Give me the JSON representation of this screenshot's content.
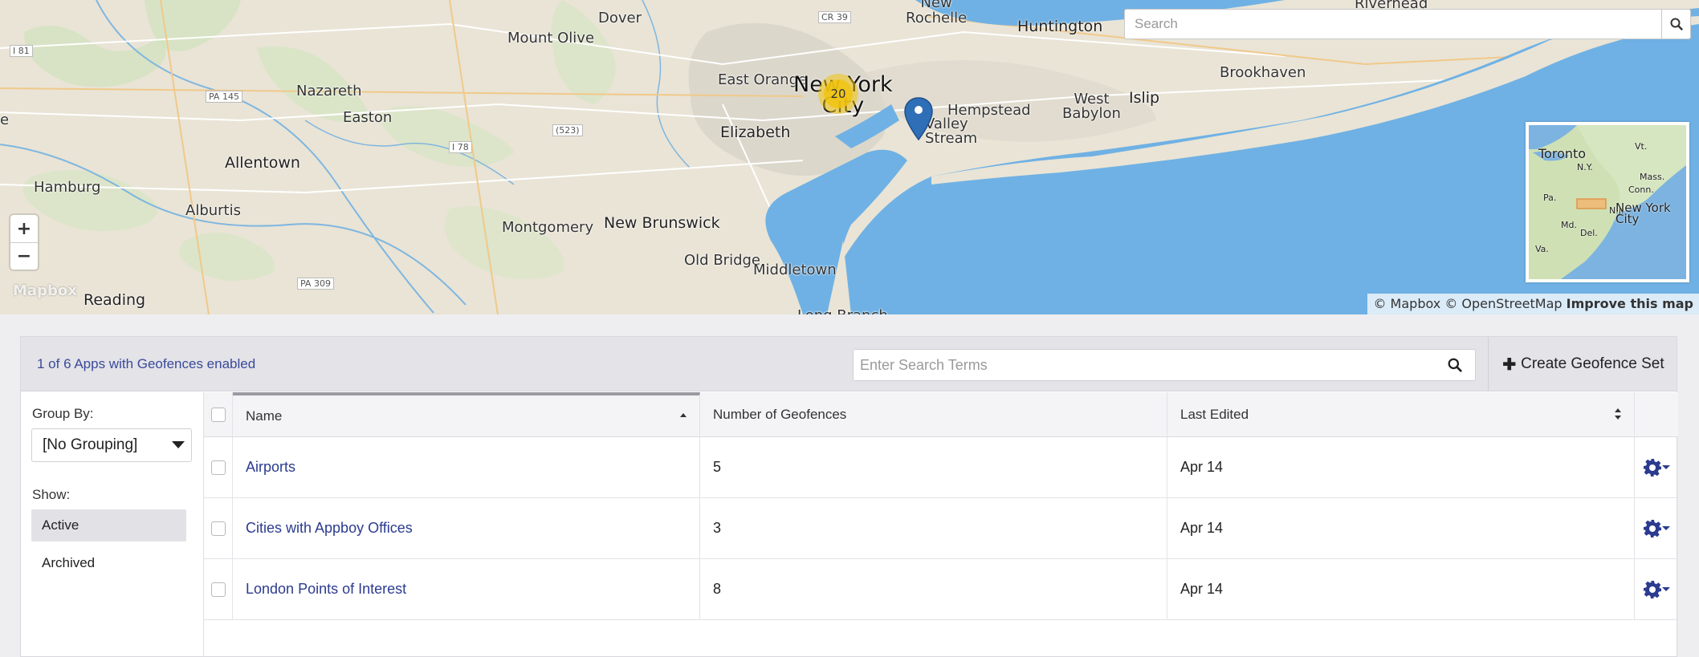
{
  "map": {
    "search_placeholder": "Search",
    "zoom_in": "+",
    "zoom_out": "−",
    "logo": "Mapbox",
    "cluster_count": "20",
    "labels": {
      "dover": "Dover",
      "new_rochelle": "New\nRochelle",
      "riverhead": "Riverhead",
      "huntington": "Huntington",
      "mount_olive": "Mount Olive",
      "cr39": "CR 39",
      "i81": "I 81",
      "east_orange": "East Orange",
      "new_york_city": "New York\nCity",
      "brookhaven": "Brookhaven",
      "nazareth": "Nazareth",
      "pa145": "PA 145",
      "hempstead": "Hempstead",
      "west_babylon": "West\nBabylon",
      "islip": "Islip",
      "easton": "Easton",
      "r523": "(523)",
      "elizabeth": "Elizabeth",
      "valley_stream": "Valley\nStream",
      "i78": "I 78",
      "allentown": "Allentown",
      "hamburg": "Hamburg",
      "alburtis": "Alburtis",
      "montgomery": "Montgomery",
      "new_brunswick": "New Brunswick",
      "old_bridge": "Old Bridge",
      "middletown": "Middletown",
      "pa309": "PA 309",
      "reading": "Reading",
      "long_branch": "Long Branch",
      "e": "e"
    },
    "minimap": {
      "toronto": "Toronto",
      "vt": "Vt.",
      "ny": "N.Y.",
      "mass": "Mass.",
      "conn": "Conn.",
      "pa": "Pa.",
      "md": "Md.",
      "del": "Del.",
      "nj": "N.J.",
      "va": "Va.",
      "nyc": "New York\nCity"
    },
    "attribution": {
      "mapbox": "© Mapbox",
      "osm": "© OpenStreetMap",
      "improve": "Improve this map"
    }
  },
  "header": {
    "app_count": "1 of 6 Apps with Geofences enabled",
    "search_placeholder": "Enter Search Terms",
    "create_label": "Create Geofence Set"
  },
  "sidebar": {
    "group_by_label": "Group By:",
    "group_by_value": "[No Grouping]",
    "show_label": "Show:",
    "show_options": [
      "Active",
      "Archived"
    ],
    "selected_show": "Active"
  },
  "table": {
    "columns": [
      "Name",
      "Number of Geofences",
      "Last Edited"
    ],
    "rows": [
      {
        "name": "Airports",
        "count": "5",
        "edited": "Apr 14"
      },
      {
        "name": "Cities with Appboy Offices",
        "count": "3",
        "edited": "Apr 14"
      },
      {
        "name": "London Points of Interest",
        "count": "8",
        "edited": "Apr 14"
      }
    ]
  },
  "colors": {
    "link": "#2b3b8f",
    "water": "#6fb1e4",
    "land": "#e9e4d6",
    "cluster": "#f1c40f",
    "pin": "#2f6fb7",
    "gear": "#2b3b8f"
  }
}
